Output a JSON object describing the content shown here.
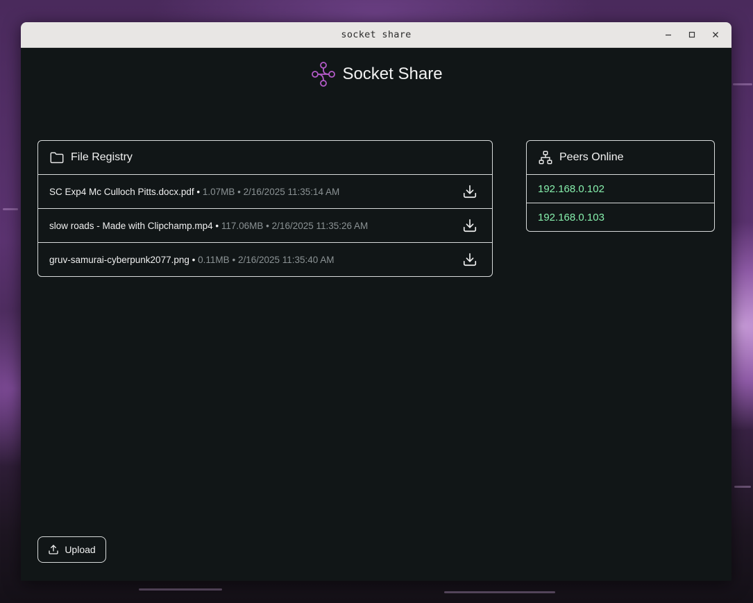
{
  "window": {
    "title": "socket share",
    "controls": [
      "minimize-icon",
      "maximize-icon",
      "close-icon"
    ]
  },
  "app": {
    "title": "Socket Share",
    "logo_icon": "share-nodes-icon",
    "accent_color": "#b45bc9"
  },
  "registry": {
    "title": "File Registry",
    "icon": "folder-icon",
    "files": [
      {
        "name": "SC Exp4 Mc Culloch Pitts.docx.pdf",
        "size": "1.07MB",
        "timestamp": "2/16/2025 11:35:14 AM"
      },
      {
        "name": "slow roads - Made with Clipchamp.mp4",
        "size": "117.06MB",
        "timestamp": "2/16/2025 11:35:26 AM"
      },
      {
        "name": "gruv-samurai-cyberpunk2077.png",
        "size": "0.11MB",
        "timestamp": "2/16/2025 11:35:40 AM"
      }
    ],
    "separator": "•",
    "download_icon": "download-icon"
  },
  "peers": {
    "title": "Peers Online",
    "icon": "network-icon",
    "list": [
      "192.168.0.102",
      "192.168.0.103"
    ],
    "ip_color": "#86efac"
  },
  "upload": {
    "label": "Upload",
    "icon": "upload-icon"
  }
}
